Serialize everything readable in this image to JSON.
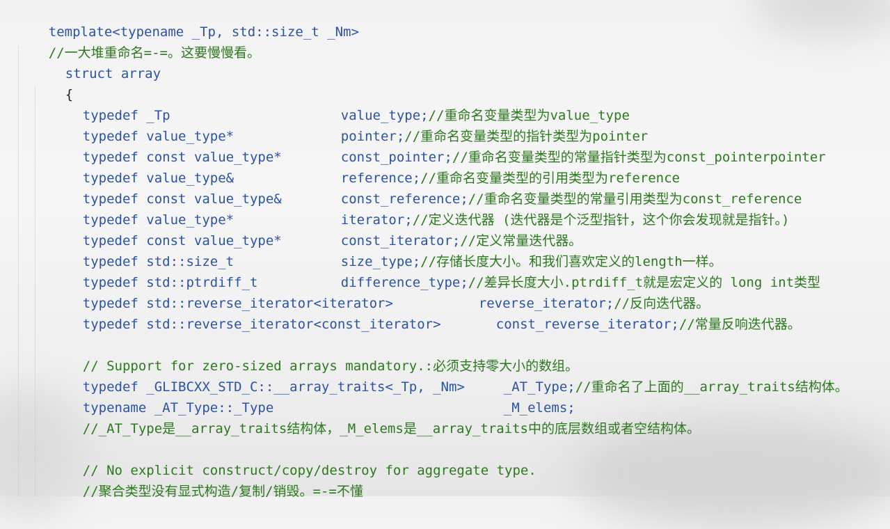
{
  "lines": [
    {
      "text": "template<typename _Tp, std::size_t _Nm>",
      "color": "#2a53a6"
    },
    {
      "text": "//一大堆重命名=-=。这要慢慢看。",
      "color": "#2b7a1d"
    },
    {
      "text": "struct array",
      "color": "#2a53a6"
    },
    {
      "text": "{",
      "color": "#222222"
    },
    {
      "decl": "typedef _Tp",
      "rest": "value_type;",
      "comment": "//重命名变量类型为value_type"
    },
    {
      "decl": "typedef value_type*",
      "rest": "pointer;",
      "comment": "//重命名变量类型的指针类型为pointer"
    },
    {
      "decl": "typedef const value_type*",
      "rest": "const_pointer;",
      "comment": "//重命名变量类型的常量指针类型为const_pointerpointer"
    },
    {
      "decl": "typedef value_type&",
      "rest": "reference;",
      "comment": "//重命名变量类型的引用类型为reference"
    },
    {
      "decl": "typedef const value_type&",
      "rest": "const_reference;",
      "comment": "//重命名变量类型的常量引用类型为const_reference"
    },
    {
      "decl": "typedef value_type*",
      "rest": "iterator;",
      "comment": "//定义迭代器 (迭代器是个泛型指针，这个你会发现就是指针。)"
    },
    {
      "decl": "typedef const value_type*",
      "rest": "const_iterator;",
      "comment": "//定义常量迭代器。"
    },
    {
      "decl": "typedef std::size_t",
      "rest": "size_type;",
      "comment": "//存储长度大小。和我们喜欢定义的length一样。"
    },
    {
      "decl": "typedef std::ptrdiff_t",
      "rest": "difference_type;",
      "comment": "//差异长度大小.ptrdiff_t就是宏定义的 long int类型"
    },
    {
      "decl": "typedef std::reverse_iterator<iterator>",
      "rest": "reverse_iterator;",
      "comment": "//反向迭代器。"
    },
    {
      "decl": "typedef std::reverse_iterator<const_iterator>",
      "rest": "const_reverse_iterator;",
      "comment": "//常量反响迭代器。"
    },
    {
      "text": "// Support for zero-sized arrays mandatory.:必须支持零大小的数组。",
      "color": "#2b7a1d"
    },
    {
      "decl": "typedef _GLIBCXX_STD_C::__array_traits<_Tp, _Nm>",
      "rest": "_AT_Type;",
      "comment": "//重命名了上面的__array_traits结构体。"
    },
    {
      "decl": "typename _AT_Type::_Type",
      "rest": "_M_elems;",
      "comment": ""
    },
    {
      "text": "//_AT_Type是__array_traits结构体，_M_elems是__array_traits中的底层数组或者空结构体。",
      "color": "#2b7a1d"
    },
    {
      "text": "// No explicit construct/copy/destroy for aggregate type.",
      "color": "#2b7a1d"
    },
    {
      "text": "//聚合类型没有显式构造/复制/销毁。=-=不懂",
      "color": "#2b7a1d"
    }
  ]
}
